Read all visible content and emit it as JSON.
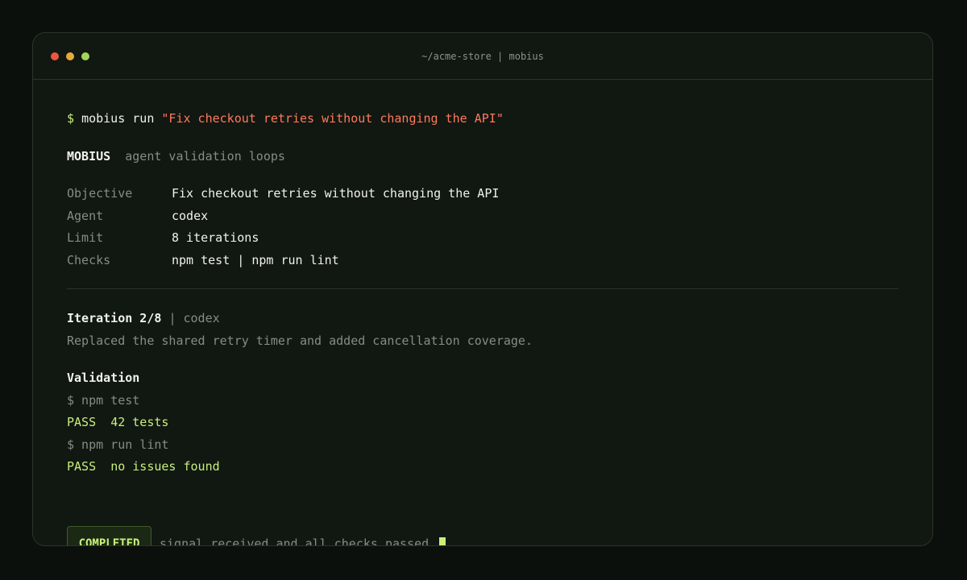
{
  "window": {
    "title": "~/acme-store | mobius"
  },
  "command": {
    "prompt": "$",
    "text": "mobius run",
    "argument": "\"Fix checkout retries without changing the API\""
  },
  "header": {
    "app": "MOBIUS",
    "tagline": "agent validation loops"
  },
  "config": [
    {
      "key": "Objective",
      "value": "Fix checkout retries without changing the API"
    },
    {
      "key": "Agent",
      "value": "codex"
    },
    {
      "key": "Limit",
      "value": "8 iterations"
    },
    {
      "key": "Checks",
      "value": "npm test | npm run lint"
    }
  ],
  "iteration": {
    "label": "Iteration 2/8",
    "separator": "|",
    "agent": "codex",
    "summary": "Replaced the shared retry timer and added cancellation coverage."
  },
  "validation": {
    "heading": "Validation",
    "steps": [
      {
        "command": "$ npm test",
        "status": "PASS",
        "detail": "42 tests"
      },
      {
        "command": "$ npm run lint",
        "status": "PASS",
        "detail": "no issues found"
      }
    ]
  },
  "result": {
    "badge": "COMPLETED",
    "message": "signal received and all checks passed."
  },
  "colors": {
    "background": "#0c100c",
    "window": "#111711",
    "accent_green": "#c7f07a",
    "string_red": "#ff7a5c",
    "dim": "#858d85"
  }
}
